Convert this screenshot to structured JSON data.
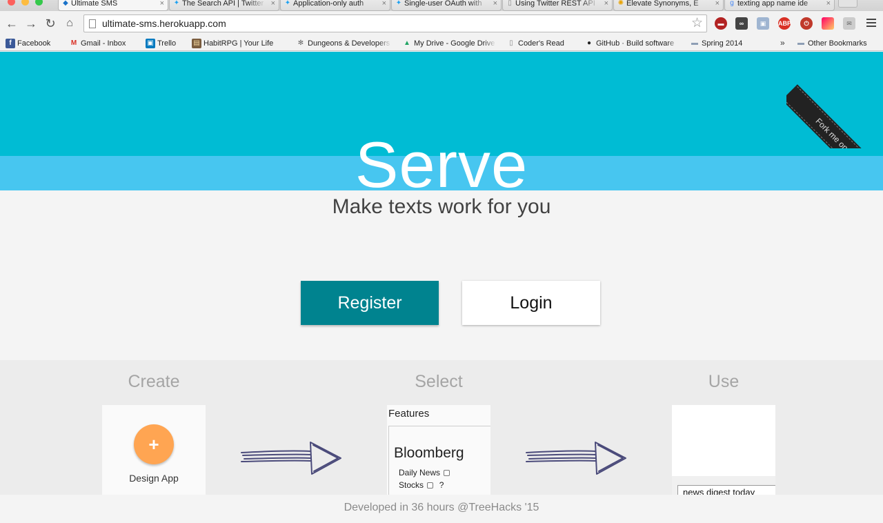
{
  "browser": {
    "tabs": [
      {
        "label": "Ultimate SMS",
        "icon": "heroku-icon",
        "active": true
      },
      {
        "label": "The Search API | Twitter",
        "icon": "twitter-icon"
      },
      {
        "label": "Application-only auth",
        "icon": "twitter-icon"
      },
      {
        "label": "Single-user OAuth with",
        "icon": "twitter-icon"
      },
      {
        "label": "Using Twitter REST API",
        "icon": "page-icon"
      },
      {
        "label": "Elevate Synonyms, E",
        "icon": "thesaurus-icon"
      },
      {
        "label": "texting app name ide",
        "icon": "google-icon"
      }
    ],
    "url": "ultimate-sms.herokuapp.com",
    "bookmarks": [
      {
        "label": "Facebook",
        "icon": "facebook-icon",
        "glyph": "f",
        "color": "#3b5998"
      },
      {
        "label": "Gmail - Inbox",
        "icon": "gmail-icon",
        "glyph": "M",
        "color": "#d93025"
      },
      {
        "label": "Trello",
        "icon": "trello-icon",
        "glyph": "▣",
        "color": "#0079bf"
      },
      {
        "label": "HabitRPG | Your Life",
        "icon": "habitrpg-icon",
        "glyph": "▤",
        "color": "#7a5c3e"
      },
      {
        "label": "Dungeons & Developers",
        "icon": "gear-icon",
        "glyph": "✻",
        "color": "#666666"
      },
      {
        "label": "My Drive - Google Drive",
        "icon": "google-drive-icon",
        "glyph": "▲",
        "color": "#1fa463"
      },
      {
        "label": "Coder's Read",
        "icon": "page-icon",
        "glyph": "▯",
        "color": "#888888"
      },
      {
        "label": "GitHub · Build software",
        "icon": "github-icon",
        "glyph": "●",
        "color": "#222222"
      },
      {
        "label": "Spring 2014",
        "icon": "folder-icon",
        "glyph": "▬",
        "color": "#8e9eb5"
      }
    ],
    "overflow_chevron": "»",
    "other_bookmarks": "Other Bookmarks"
  },
  "hero": {
    "title": "Serve",
    "tagline": "Make texts work for you",
    "ribbon": "Fork me on GitHub",
    "colors": {
      "top": "#00bcd4",
      "band": "#47c6f0"
    }
  },
  "actions": {
    "register": "Register",
    "login": "Login",
    "register_color": "#00838f"
  },
  "steps": {
    "create": {
      "title": "Create",
      "plus": "+",
      "label": "Design App",
      "fab_color": "#ffa552"
    },
    "select": {
      "title": "Select",
      "header": "Features",
      "company": "Bloomberg",
      "features": [
        {
          "label": "Daily News",
          "suffix": ""
        },
        {
          "label": "Stocks",
          "suffix": "?"
        }
      ]
    },
    "use": {
      "title": "Use",
      "input_value": "news digest today"
    }
  },
  "footer": {
    "text": "Developed in 36 hours @TreeHacks '15"
  }
}
